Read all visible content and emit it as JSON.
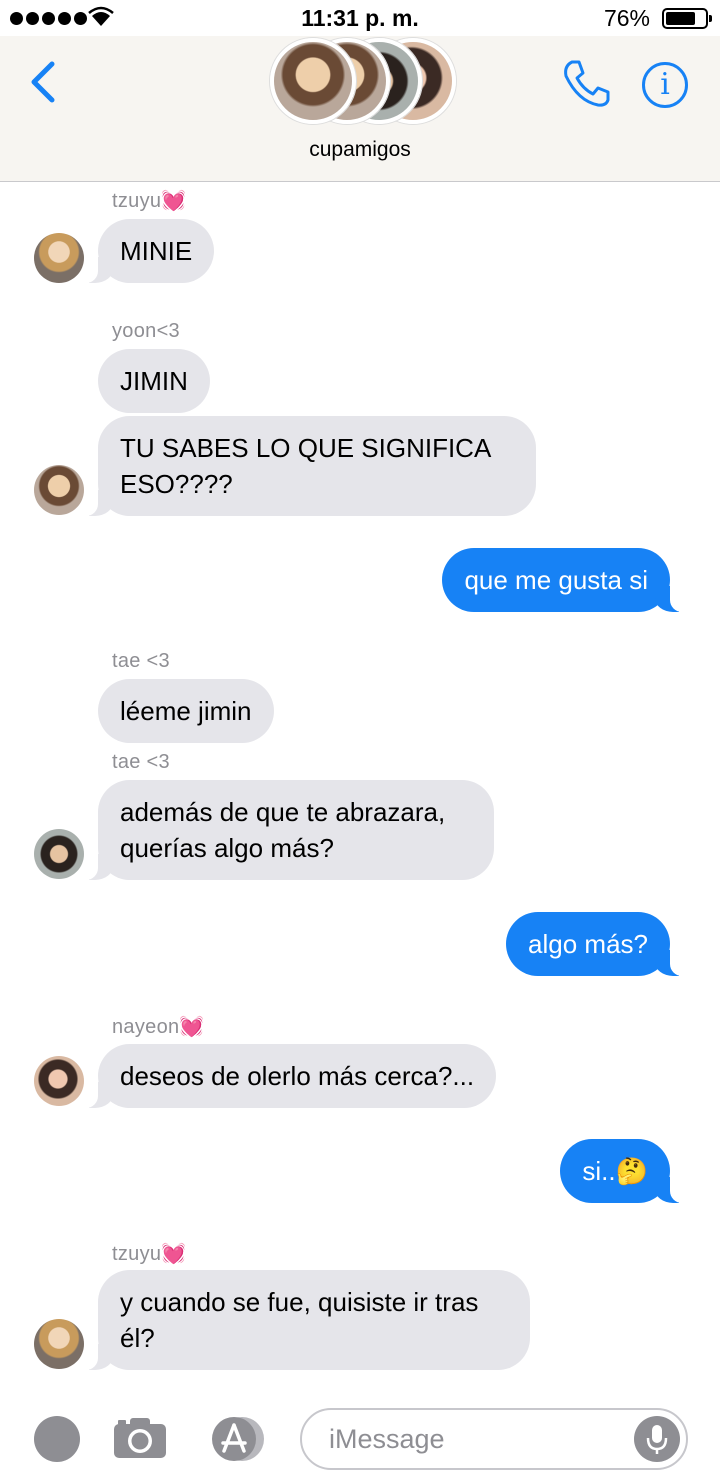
{
  "status_bar": {
    "time": "11:31 p. m.",
    "battery_percent": "76%",
    "battery_level": 0.76,
    "signal_bars": 5
  },
  "header": {
    "group_name": "cupamigos",
    "back_icon": "chevron-left-icon",
    "call_icon": "phone-icon",
    "info_icon": "info-icon",
    "info_symbol": "i",
    "accent_color": "#1782f5"
  },
  "messages": [
    {
      "type": "incoming",
      "sender": "tzuyu💓",
      "text": "MINIE"
    },
    {
      "type": "incoming",
      "sender": "yoon<3",
      "text": "JIMIN"
    },
    {
      "type": "incoming",
      "text": "TU SABES LO QUE SIGNIFICA ESO????"
    },
    {
      "type": "outgoing",
      "text": "que me gusta si"
    },
    {
      "type": "incoming",
      "sender": "tae <3",
      "text": "léeme jimin"
    },
    {
      "type": "incoming",
      "sender": "tae <3",
      "text": "además de que te abrazara, querías algo más?"
    },
    {
      "type": "outgoing",
      "text": "algo más?"
    },
    {
      "type": "incoming",
      "sender": "nayeon💓",
      "text": "deseos de olerlo más cerca?..."
    },
    {
      "type": "outgoing",
      "text": "si..🤔"
    },
    {
      "type": "incoming",
      "sender": "tzuyu💓",
      "text": "y cuando se fue, quisiste ir tras él?"
    }
  ],
  "input_bar": {
    "placeholder": "iMessage",
    "bubble_incoming_color": "#e5e5ea",
    "bubble_outgoing_color": "#1782f5"
  }
}
